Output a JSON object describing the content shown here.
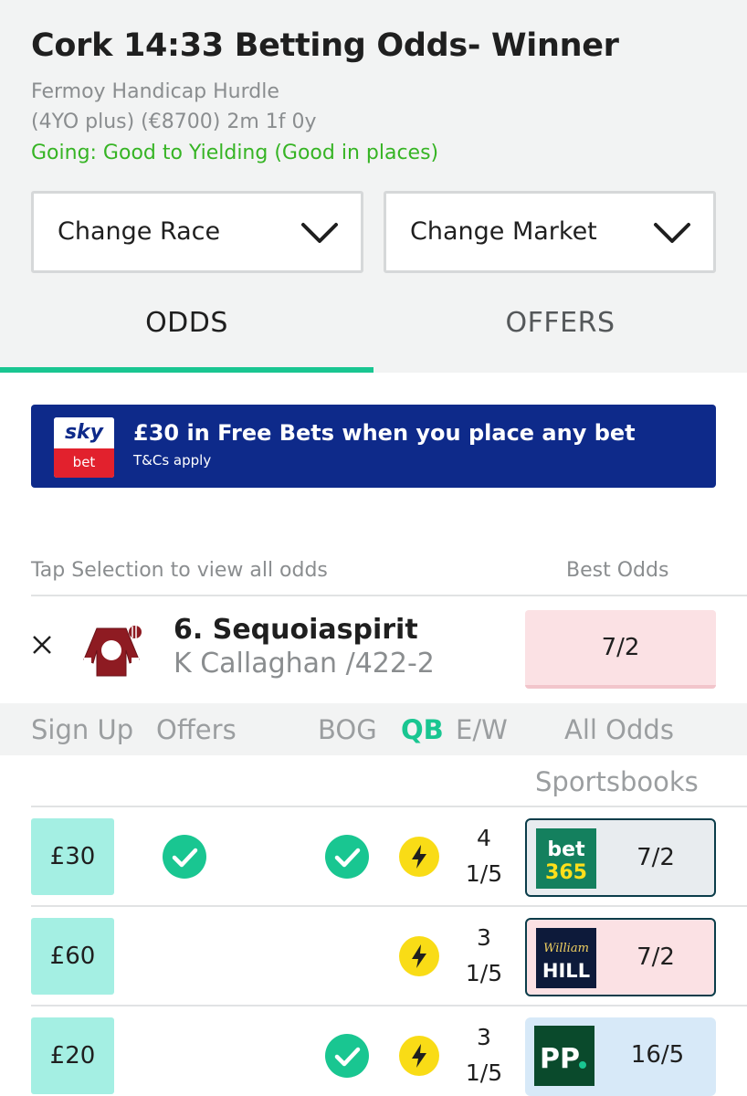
{
  "header": {
    "title": "Cork 14:33 Betting Odds- Winner",
    "race_name": "Fermoy Handicap Hurdle",
    "race_details": "(4YO plus) (€8700) 2m 1f 0y",
    "going": "Going: Good to Yielding (Good in places)"
  },
  "selects": {
    "race_label": "Change Race",
    "market_label": "Change Market"
  },
  "tabs": [
    {
      "label": "ODDS",
      "active": true
    },
    {
      "label": "OFFERS",
      "active": false
    }
  ],
  "banner": {
    "logo_top": "sky",
    "logo_bottom": "bet",
    "headline": "£30 in Free Bets when you place any bet",
    "terms": "T&Cs apply"
  },
  "list_header": {
    "left": "Tap Selection to view all odds",
    "right": "Best Odds"
  },
  "selection": {
    "name": "6. Sequoiaspirit",
    "info": "K Callaghan /422-2",
    "best_odds": "7/2"
  },
  "filters": {
    "sign_up": "Sign Up",
    "offers": "Offers",
    "bog": "BOG",
    "qb": "QB",
    "ew": "E/W",
    "all_odds": "All Odds",
    "sportsbooks": "Sportsbooks"
  },
  "bookmakers": [
    {
      "sign_up": "£30",
      "offers": true,
      "bog": true,
      "qb": true,
      "ew_places": "4",
      "ew_fraction": "1/5",
      "logo": "bet365-logo",
      "logo_line1": "bet",
      "logo_line2": "365",
      "odds": "7/2"
    },
    {
      "sign_up": "£60",
      "offers": false,
      "bog": false,
      "qb": true,
      "ew_places": "3",
      "ew_fraction": "1/5",
      "logo": "william-hill-logo",
      "logo_line1": "William",
      "logo_line2": "HILL",
      "odds": "7/2"
    },
    {
      "sign_up": "£20",
      "offers": false,
      "bog": true,
      "qb": true,
      "ew_places": "3",
      "ew_fraction": "1/5",
      "logo": "paddy-power-logo",
      "logo_line1": "PP",
      "logo_line2": "",
      "odds": "16/5"
    }
  ],
  "colors": {
    "accent_green": "#19c691",
    "going_green": "#36b424",
    "banner_blue": "#0e2a8a",
    "signup_teal": "#a4efe3",
    "odds_pink": "#fbe1e4",
    "qb_yellow": "#f9dc16"
  }
}
